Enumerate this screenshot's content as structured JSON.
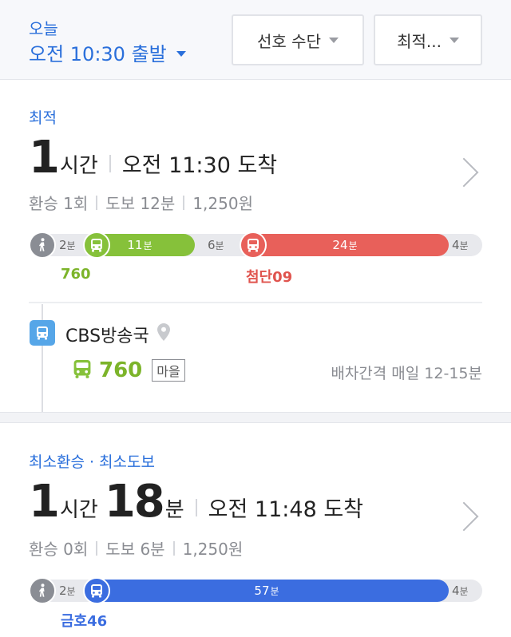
{
  "header": {
    "day": "오늘",
    "departure": "오전 10:30 출발",
    "pref_button": "선호 수단",
    "sort_button": "최적..."
  },
  "routes": [
    {
      "tag": "최적",
      "hours": "1",
      "hours_unit": "시간",
      "minutes": "",
      "minutes_unit": "",
      "arrival": "오전 11:30 도착",
      "transfers": "환승 1회",
      "walk": "도보 12분",
      "fare": "1,250원",
      "timeline": {
        "walk_start": "2",
        "walk_start_unit": "분",
        "segments": [
          {
            "minutes": "11",
            "unit": "분",
            "route": "760",
            "color": "#86c13a"
          },
          {
            "minutes": "24",
            "unit": "분",
            "route": "첨단09",
            "color": "#e8605a"
          }
        ],
        "mid_walk": "6",
        "mid_walk_unit": "분",
        "walk_end": "4",
        "walk_end_unit": "분"
      },
      "detail": {
        "stop": "CBS방송국",
        "bus_number": "760",
        "bus_kind": "마을",
        "interval": "배차간격 매일 12-15분"
      }
    },
    {
      "tag": "최소환승 · 최소도보",
      "hours": "1",
      "hours_unit": "시간",
      "minutes": "18",
      "minutes_unit": "분",
      "arrival": "오전 11:48 도착",
      "transfers": "환승 0회",
      "walk": "도보 6분",
      "fare": "1,250원",
      "timeline": {
        "walk_start": "2",
        "walk_start_unit": "분",
        "segments": [
          {
            "minutes": "57",
            "unit": "분",
            "route": "금호46",
            "color": "#3b6de0"
          }
        ],
        "walk_end": "4",
        "walk_end_unit": "분"
      }
    }
  ],
  "colors": {
    "accent": "#2a6fdb",
    "green_bus": "#86c13a",
    "red_bus": "#e8605a",
    "blue_bus": "#3b6de0",
    "stop_icon": "#56a6e8"
  },
  "icons": {
    "walk": "walking-person-icon",
    "bus": "bus-icon",
    "pin": "location-pin-icon",
    "chevron": "chevron-right-icon"
  }
}
